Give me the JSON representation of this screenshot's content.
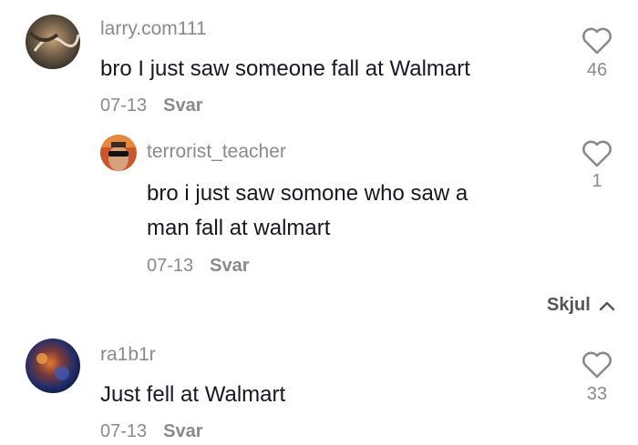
{
  "comments": [
    {
      "username": "larry.com111",
      "text": "bro I just saw someone fall at Walmart",
      "date": "07-13",
      "reply_label": "Svar",
      "likes": "46"
    },
    {
      "username": "terrorist_teacher",
      "text_line1": "bro i just saw somone who saw a",
      "text_line2": "man fall at walmart",
      "date": "07-13",
      "reply_label": "Svar",
      "likes": "1"
    },
    {
      "username": "ra1b1r",
      "text": "Just fell at Walmart",
      "date": "07-13",
      "reply_label": "Svar",
      "likes": "33"
    }
  ],
  "hide_replies_label": "Skjul",
  "icons": {
    "like": "heart-outline-icon",
    "collapse": "chevron-up-icon"
  },
  "colors": {
    "text": "#161823",
    "muted": "#8a8a8a"
  }
}
